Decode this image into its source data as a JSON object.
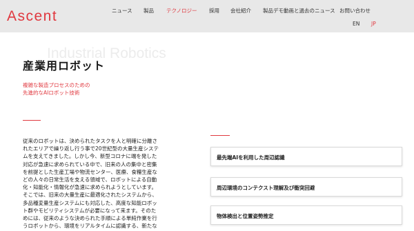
{
  "header": {
    "logo": "Ascent",
    "nav": [
      {
        "label": "ニュース",
        "active": false
      },
      {
        "label": "製品",
        "active": false
      },
      {
        "label": "テクノロジー",
        "active": true
      },
      {
        "label": "採用",
        "active": false
      },
      {
        "label": "会社紹介",
        "active": false
      },
      {
        "label": "製品デモ動画と過去のニュース",
        "active": false
      },
      {
        "label": "お問い合わせ",
        "active": false
      }
    ],
    "lang": {
      "en": "EN",
      "jp": "JP"
    }
  },
  "hero": {
    "background_title": "Industrial Robotics",
    "title": "産業用ロボット",
    "subtitle_lines": [
      "複雑な製造プロセスのための",
      "先進的なAIロボット技術"
    ]
  },
  "body_lines": [
    "従来のロボットは、決められたタスクを人と明確に分離さ",
    "れたエリアで繰り返し行う事で20世紀型の大量生産システ",
    "ムを支えてきました。しかし今、新型コロナに端を発した",
    "対応が急速に求められている中で、旧来の人の集中と密集",
    "を前提とした生産工場や物流センター、医療、食糧生産な",
    "どの人々の日常生活を支える領域で、ロボットによる自動",
    "化・知能化・情報化が急速に求められようとしています。",
    "そこでは、旧来の大量生産に最適化されたシステムから、",
    "多品種変量生産システムにも対応した、高度な知能ロボッ",
    "ト群やモビリティシステムが必要になって来ます。そのた",
    "めには、従来のような決められた手順による単純作業を行",
    "うロボットから、環境をリアルタイムに認識する、新たな"
  ],
  "feature_cards": [
    "最先端AIを利用した周辺認識",
    "周辺環境のコンテクスト理解及び衝突回避",
    "物体検出と位置姿勢推定"
  ],
  "colors": {
    "accent": "#e0383f",
    "header_bg": "#e8e8e8"
  }
}
